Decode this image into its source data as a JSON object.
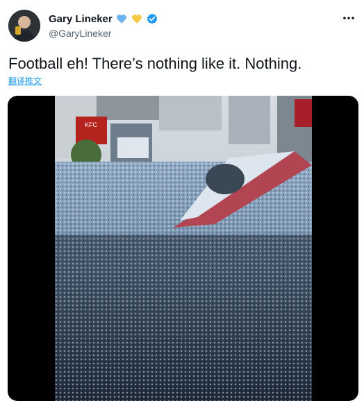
{
  "author": {
    "name": "Gary Lineker",
    "handle": "@GaryLineker",
    "badges": [
      "blue-heart-icon",
      "yellow-heart-icon",
      "verified-badge-icon"
    ]
  },
  "tweet": {
    "text": "Football eh! There’s nothing like it. Nothing.",
    "translate_link": "翻译推文"
  },
  "media": {
    "type": "video",
    "signs": [
      "KFC"
    ]
  },
  "colors": {
    "link": "#1d9bf0",
    "secondary_text": "#536471",
    "verified": "#1d9bf0",
    "heart_blue": "#6cb4ee",
    "heart_yellow": "#f7c843"
  }
}
